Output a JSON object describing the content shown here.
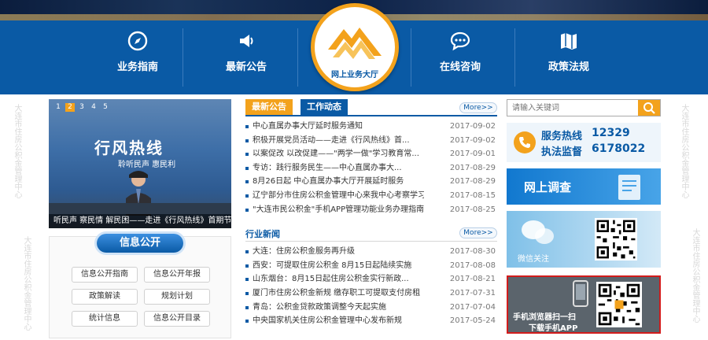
{
  "nav": {
    "items": [
      {
        "label": "业务指南",
        "icon": "compass-icon"
      },
      {
        "label": "最新公告",
        "icon": "megaphone-icon"
      },
      {
        "label": "在线咨询",
        "icon": "chat-icon"
      },
      {
        "label": "政策法规",
        "icon": "map-book-icon"
      }
    ],
    "center_label": "网上业务大厅"
  },
  "slider": {
    "pages": [
      "1",
      "2",
      "3",
      "4",
      "5"
    ],
    "active_page": "2",
    "headline": "行风热线",
    "subline": "聆听民声  惠民利",
    "caption": "听民声 察民情 解民困——走进《行风热线》首期节"
  },
  "info_public": {
    "title": "信息公开",
    "buttons": [
      "信息公开指南",
      "信息公开年报",
      "政策解读",
      "规划计划",
      "统计信息",
      "信息公开目录"
    ]
  },
  "news_tabs": {
    "tab1": "最新公告",
    "tab2": "工作动态",
    "more": "More>>",
    "items": [
      {
        "title": "中心直属办事大厅延时服务通知",
        "date": "2017-09-02"
      },
      {
        "title": "积极开展党员活动——走进《行风热线》首...",
        "date": "2017-09-02"
      },
      {
        "title": "以案促改 以改促建——\"两学一做\"学习教育常...",
        "date": "2017-09-01"
      },
      {
        "title": "专访：践行服务民生——中心直属办事大...",
        "date": "2017-08-29"
      },
      {
        "title": "8月26日起 中心直属办事大厅开展延时服务",
        "date": "2017-08-29"
      },
      {
        "title": "辽宁部分市住房公积金管理中心来我中心考察学习",
        "date": "2017-08-15"
      },
      {
        "title": "\"大连市民公积金\"手机APP管理功能业务办理指南",
        "date": "2017-08-25"
      }
    ]
  },
  "industry": {
    "title": "行业新闻",
    "more": "More>>",
    "items": [
      {
        "title": "大连：住房公积金服务再升级",
        "date": "2017-08-30"
      },
      {
        "title": "西安：可提取住房公积金 8月15日起陆续实施",
        "date": "2017-08-08"
      },
      {
        "title": "山东烟台：8月15日起住房公积金实行新政...",
        "date": "2017-08-21"
      },
      {
        "title": "厦门市住房公积金新规 缴存职工可提取支付房租",
        "date": "2017-07-31"
      },
      {
        "title": "青岛：公积金贷款政策调整今天起实施",
        "date": "2017-07-04"
      },
      {
        "title": "中央国家机关住房公积金管理中心发布新规",
        "date": "2017-05-24"
      }
    ]
  },
  "right": {
    "search_placeholder": "请输入关键词",
    "hotline_label": "服务热线",
    "hotline_number": "12329",
    "supervise_label": "执法监督",
    "supervise_number": "6178022",
    "survey_label": "网上调查",
    "wechat_label": "微信关注",
    "app_line1": "手机浏览器扫一扫",
    "app_line2": "下载手机APP"
  },
  "watermark": "大连市住房公积金管理中心",
  "colors": {
    "primary": "#0a5aa5",
    "accent": "#f3a21c",
    "highlight": "#d21c1c"
  }
}
